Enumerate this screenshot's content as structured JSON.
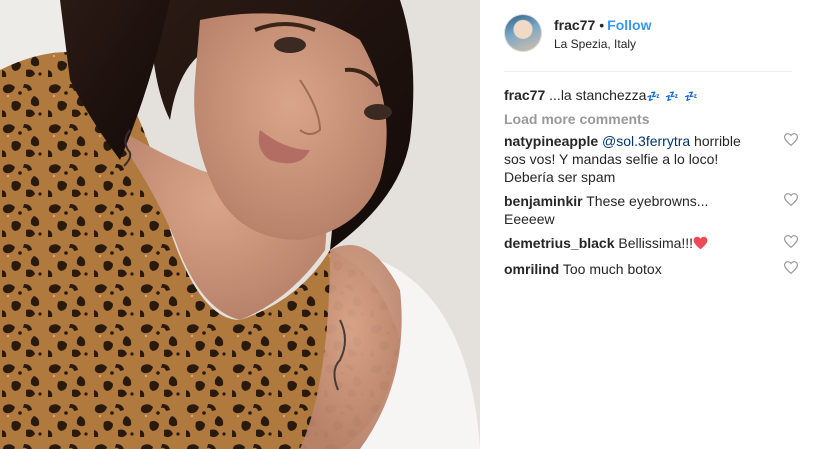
{
  "post": {
    "username": "frac77",
    "separator": "•",
    "follow_label": "Follow",
    "location": "La Spezia, Italy"
  },
  "caption": {
    "user": "frac77",
    "text": " ...la stanchezza",
    "emoji": "💤 💤 💤"
  },
  "load_more_label": "Load more comments",
  "comments": [
    {
      "user": "natypineapple",
      "mention": "@sol.3ferrytra",
      "text": " horrible sos vos! Y mandas selfie a lo loco! Debería ser spam"
    },
    {
      "user": "benjaminkir",
      "text": " These eyebrowns... Eeeeew"
    },
    {
      "user": "demetrius_black",
      "text": " Bellissima!!!",
      "emoji": "❤"
    },
    {
      "user": "omrilind",
      "text": " Too much botox"
    }
  ],
  "colors": {
    "link_blue": "#3897f0",
    "muted_gray": "#999999",
    "text": "#262626",
    "heart_red": "#ed4956"
  }
}
